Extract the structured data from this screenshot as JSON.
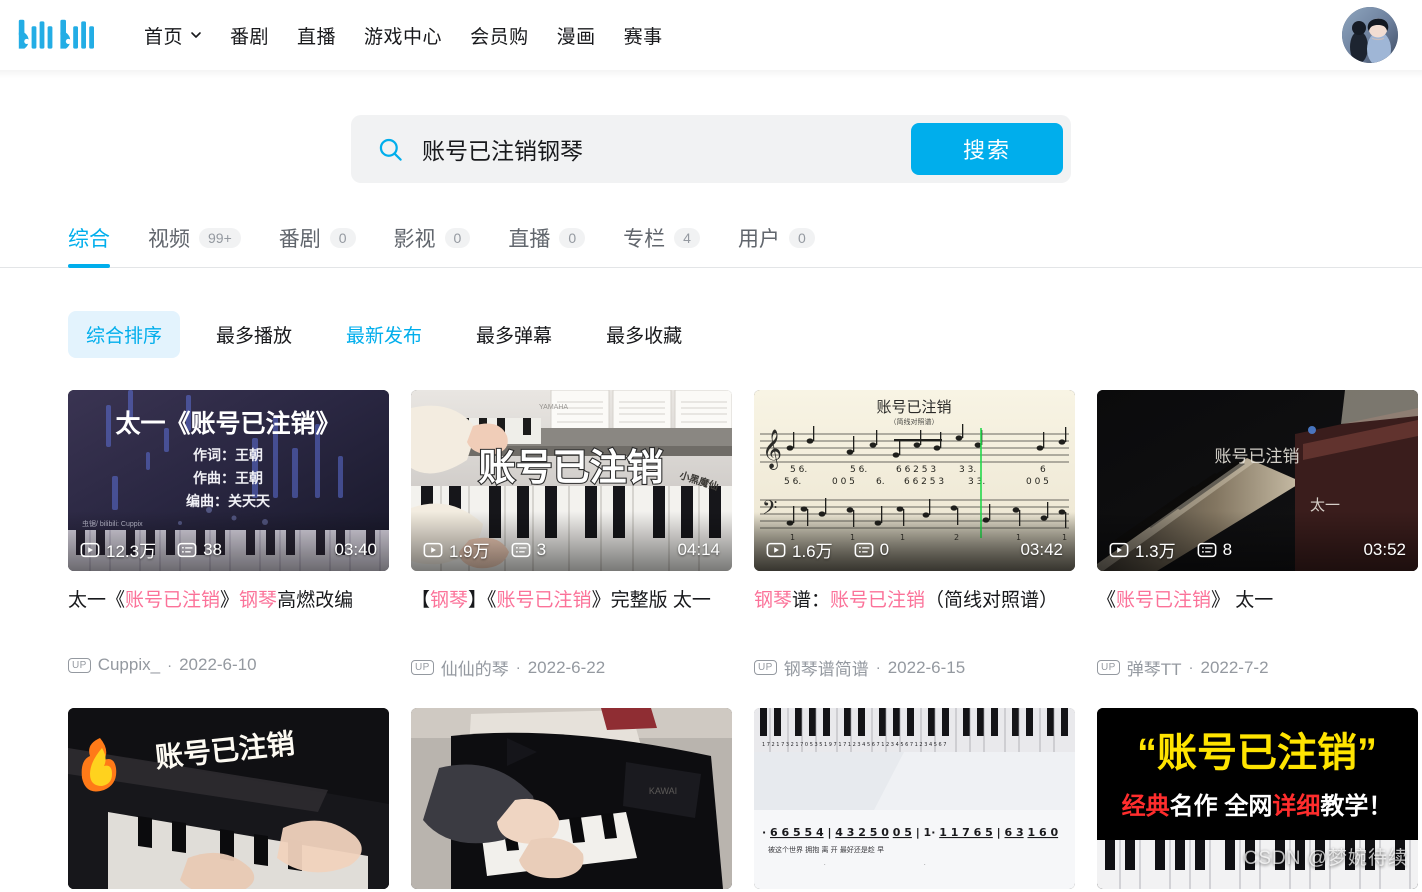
{
  "header": {
    "logo_alt": "bilibili",
    "nav": [
      {
        "label": "首页",
        "has_chevron": true
      },
      {
        "label": "番剧",
        "has_chevron": false
      },
      {
        "label": "直播",
        "has_chevron": false
      },
      {
        "label": "游戏中心",
        "has_chevron": false
      },
      {
        "label": "会员购",
        "has_chevron": false
      },
      {
        "label": "漫画",
        "has_chevron": false
      },
      {
        "label": "赛事",
        "has_chevron": false
      }
    ],
    "avatar_name": "user-avatar"
  },
  "search": {
    "value": "账号已注销钢琴",
    "placeholder": "搜索",
    "button_label": "搜索",
    "icon": "search-icon"
  },
  "tabs": [
    {
      "label": "综合",
      "count": "",
      "active": true
    },
    {
      "label": "视频",
      "count": "99+",
      "active": false
    },
    {
      "label": "番剧",
      "count": "0",
      "active": false
    },
    {
      "label": "影视",
      "count": "0",
      "active": false
    },
    {
      "label": "直播",
      "count": "0",
      "active": false
    },
    {
      "label": "专栏",
      "count": "4",
      "active": false
    },
    {
      "label": "用户",
      "count": "0",
      "active": false
    }
  ],
  "sort_options": [
    {
      "label": "综合排序",
      "state": "active"
    },
    {
      "label": "最多播放",
      "state": "normal"
    },
    {
      "label": "最新发布",
      "state": "hovered"
    },
    {
      "label": "最多弹幕",
      "state": "normal"
    },
    {
      "label": "最多收藏",
      "state": "normal"
    }
  ],
  "results": [
    {
      "title_parts": [
        {
          "t": "太一《",
          "hl": false
        },
        {
          "t": "账号已注销",
          "hl": true
        },
        {
          "t": "》",
          "hl": false
        },
        {
          "t": "钢琴",
          "hl": true
        },
        {
          "t": "高燃改编",
          "hl": false
        }
      ],
      "views": "12.3万",
      "danmaku": "38",
      "duration": "03:40",
      "uploader": "Cuppix_",
      "date": "2022-6-10",
      "thumb": {
        "kind": "title-card-dark",
        "main_text": "太一《账号已注销》",
        "lines": [
          "作词：王朝",
          "作曲：王朝",
          "编曲：关天天"
        ],
        "corner_text": "虫锯/ bilibili: Cuppix"
      }
    },
    {
      "title_parts": [
        {
          "t": "【",
          "hl": false
        },
        {
          "t": "钢琴",
          "hl": true
        },
        {
          "t": "】《",
          "hl": false
        },
        {
          "t": "账号已注销",
          "hl": true
        },
        {
          "t": "》完整版 太一",
          "hl": false
        }
      ],
      "views": "1.9万",
      "danmaku": "3",
      "duration": "04:14",
      "uploader": "仙仙的琴",
      "date": "2022-6-22",
      "thumb": {
        "kind": "piano-hands-light",
        "main_text": "账号已注销",
        "corner_text": "小黑魔仙",
        "brand_text": "YAMAHA"
      }
    },
    {
      "title_parts": [
        {
          "t": "钢琴",
          "hl": true
        },
        {
          "t": "谱：",
          "hl": false
        },
        {
          "t": "账号已注销",
          "hl": true
        },
        {
          "t": "（简线对照谱）",
          "hl": false
        }
      ],
      "views": "1.6万",
      "danmaku": "0",
      "duration": "03:42",
      "uploader": "钢琴谱简谱",
      "date": "2022-6-15",
      "thumb": {
        "kind": "sheet-music",
        "main_text": "账号已注销",
        "sub_text": "（简线对照谱）"
      }
    },
    {
      "title_parts": [
        {
          "t": "《",
          "hl": false
        },
        {
          "t": "账号已注销",
          "hl": true
        },
        {
          "t": "》 太一",
          "hl": false
        }
      ],
      "views": "1.3万",
      "danmaku": "8",
      "duration": "03:52",
      "uploader": "弹琴TT",
      "date": "2022-7-2",
      "thumb": {
        "kind": "dark-piano",
        "main_text": "账号已注销",
        "sub_text": "太一"
      }
    }
  ],
  "results_row2": [
    {
      "thumb": {
        "kind": "fire-piano",
        "main_text": "账号已注销"
      }
    },
    {
      "thumb": {
        "kind": "black-piano",
        "main_text": ""
      }
    },
    {
      "thumb": {
        "kind": "numbered-score",
        "numbers": "· 6 6 5 5 4 | 4 3 2 5 0   0 5 | 1·   1 1 7 6 5 | 6 3   1 6 0",
        "lyrics": "被这个世界  拥抱       离 开   最好还是趁 早"
      }
    },
    {
      "thumb": {
        "kind": "yellow-title",
        "main_text": "“账号已注销”",
        "sub_parts": [
          {
            "t": "经典",
            "color": "#ff2d2d"
          },
          {
            "t": "名作 全网",
            "color": "#ffffff"
          },
          {
            "t": "详细",
            "color": "#ff2d2d"
          },
          {
            "t": "教学！",
            "color": "#ffffff"
          }
        ]
      }
    }
  ],
  "watermark": "CSDN @梦婉待续",
  "colors": {
    "brand_blue": "#00aeec",
    "brand_pink": "#fb7299",
    "text_primary": "#18191c",
    "text_secondary": "#9499a0",
    "bg_chip": "#f1f2f3",
    "chip_active_bg": "#e3f3fd"
  }
}
